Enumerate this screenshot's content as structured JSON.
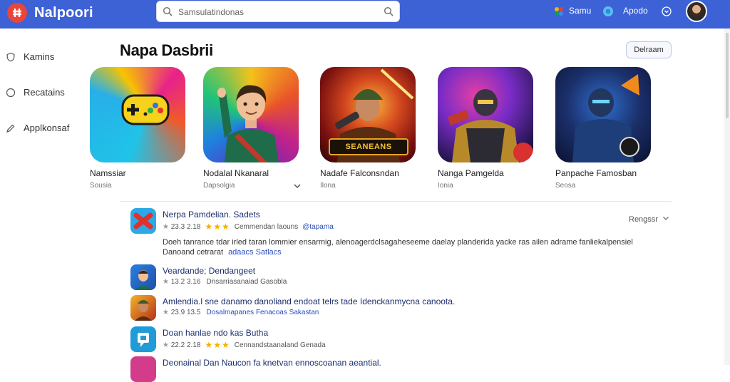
{
  "app": {
    "name": "Nalpoori",
    "search_placeholder": "Samsulatindonas",
    "header_items": [
      "Samu",
      "Apodo"
    ]
  },
  "sidebar": {
    "items": [
      {
        "label": "Kamins",
        "icon": "shield-icon"
      },
      {
        "label": "Recatains",
        "icon": "circle-icon"
      },
      {
        "label": "Applkonsaf",
        "icon": "pencil-icon"
      }
    ]
  },
  "section": {
    "title": "Napa Dasbrii",
    "see_all": "Delraam"
  },
  "cards": [
    {
      "name": "Namssiar",
      "sub": "Sousia",
      "icon": "gamepad-icon"
    },
    {
      "name": "Nodalal Nkanaral",
      "sub": "Dapsolgia",
      "icon": "character-icon"
    },
    {
      "name": "Nadafe Falconsndan",
      "sub": "Ilona",
      "icon": "soldier-icon",
      "badge": "SEANEANS"
    },
    {
      "name": "Nanga Pamgelda",
      "sub": "Ionia",
      "icon": "armor-icon"
    },
    {
      "name": "Panpache Famosban",
      "sub": "Seosa",
      "icon": "robot-icon"
    }
  ],
  "sort_label": "Rengssr",
  "list": [
    {
      "title": "Nerpa Pamdelian. Sadets",
      "rating": "23.3 2.18",
      "meta": "Cemmendan laouns",
      "tag": "@tapama",
      "desc_line1": "Doeh tanrance tdar irled taran lommier ensarmig, alenoagerdclsagaheseeme daelay planderida yacke ras ailen adrame fanliekalpensiel",
      "desc_line2": "Danoand cetrarat",
      "desc_tag": "adaacs Satlacs"
    },
    {
      "title": "Veardande; Dendangeet",
      "rating": "13.2 3.16",
      "meta": "Dnsarriasanaiad Gasobla",
      "tag": ""
    },
    {
      "title": "Amlendia.l sne danamo danoliand endoat telrs tade Idenckanmycna canoota.",
      "rating": "23.9 13.5",
      "meta": "Dosalmapanes Fenacoas Sakastan",
      "tag": ""
    },
    {
      "title": "Doan hanlae ndo kas Butha",
      "rating": "22.2 2.18",
      "meta": "Cennandstaanaland Genada",
      "tag": ""
    },
    {
      "title": "Deonainal Dan Naucon fa knetvan ennoscoanan aeantial.",
      "rating": "",
      "meta": "",
      "tag": ""
    }
  ],
  "colors": {
    "topbar": "#3d62d6",
    "accent": "#2a4fbf",
    "star": "#f2b200",
    "logo": "#e8453c"
  }
}
